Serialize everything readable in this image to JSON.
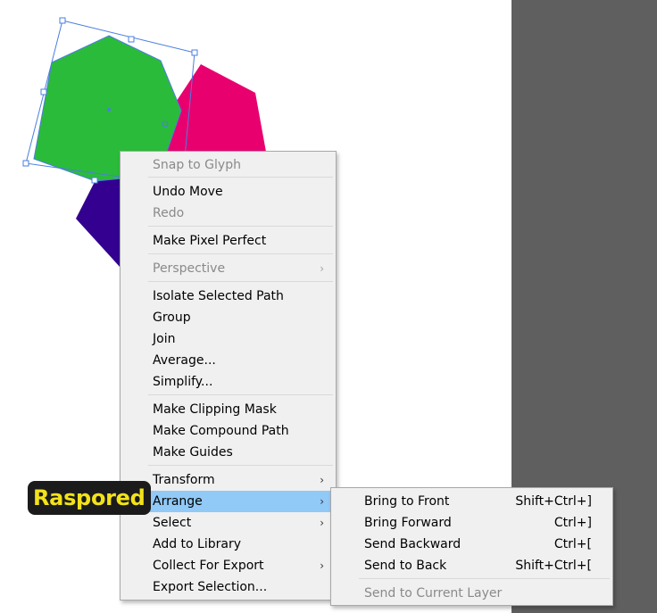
{
  "canvas": {
    "artboard_color": "#ffffff",
    "pasteboard_color": "#5f5f5f"
  },
  "shapes": [
    {
      "name": "green-heptagon",
      "color": "#2bbb3a"
    },
    {
      "name": "magenta-hexagon",
      "color": "#e8006f"
    },
    {
      "name": "purple-hexagon",
      "color": "#330090"
    }
  ],
  "selection_color": "#4a7ee0",
  "badge": {
    "text": "Raspored",
    "text_color": "#f2e21a"
  },
  "context_menu": {
    "highlight_color": "#91c9f7",
    "items": [
      {
        "label": "Snap to Glyph",
        "disabled": true
      },
      {
        "label": "Undo Move"
      },
      {
        "label": "Redo",
        "disabled": true
      },
      {
        "label": "Make Pixel Perfect"
      },
      {
        "label": "Perspective",
        "disabled": true,
        "submenu": true
      },
      {
        "label": "Isolate Selected Path"
      },
      {
        "label": "Group"
      },
      {
        "label": "Join"
      },
      {
        "label": "Average..."
      },
      {
        "label": "Simplify..."
      },
      {
        "label": "Make Clipping Mask"
      },
      {
        "label": "Make Compound Path"
      },
      {
        "label": "Make Guides"
      },
      {
        "label": "Transform",
        "submenu": true
      },
      {
        "label": "Arrange",
        "submenu": true,
        "highlighted": true
      },
      {
        "label": "Select",
        "submenu": true
      },
      {
        "label": "Add to Library"
      },
      {
        "label": "Collect For Export",
        "submenu": true
      },
      {
        "label": "Export Selection..."
      }
    ]
  },
  "arrange_submenu": {
    "items": [
      {
        "label": "Bring to Front",
        "shortcut": "Shift+Ctrl+]"
      },
      {
        "label": "Bring Forward",
        "shortcut": "Ctrl+]"
      },
      {
        "label": "Send Backward",
        "shortcut": "Ctrl+["
      },
      {
        "label": "Send to Back",
        "shortcut": "Shift+Ctrl+["
      },
      {
        "label": "Send to Current Layer",
        "disabled": true
      }
    ]
  }
}
